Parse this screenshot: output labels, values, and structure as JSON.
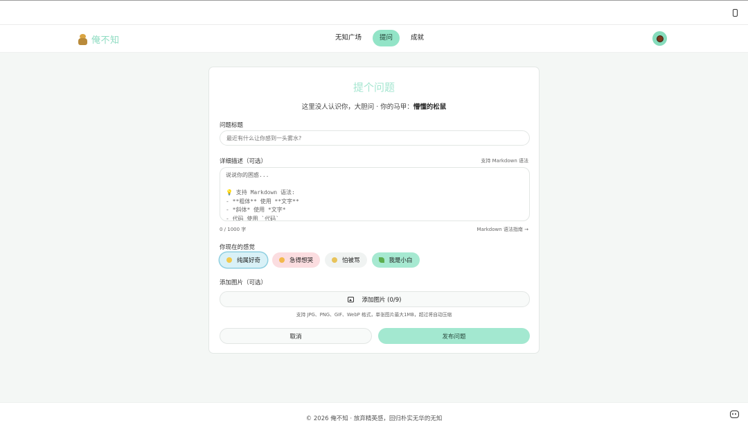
{
  "brand": {
    "name": "俺不知"
  },
  "nav": {
    "links": [
      {
        "label": "无知广场",
        "active": false
      },
      {
        "label": "提问",
        "active": true
      },
      {
        "label": "成就",
        "active": false
      }
    ]
  },
  "form": {
    "heading": "提个问题",
    "subtitle_prefix": "这里没人认识你，大胆问 · 你的马甲：",
    "alias": "懵懂的松鼠",
    "title_label": "问题标题",
    "title_placeholder": "最近有什么让你感到一头雾水?",
    "desc_label": "详细描述（可选）",
    "markdown_support": "支持 Markdown 语法",
    "desc_placeholder_lines": [
      "说说你的困惑...",
      "",
      "💡 支持 Markdown 语法:",
      "- **粗体** 使用 **文字**",
      "- *斜体* 使用 *文字*",
      "- 代码 使用 `代码`"
    ],
    "char_count": "0 / 1000 字",
    "markdown_guide": "Markdown 语法指南 →",
    "feeling_label": "你现在的感觉",
    "feelings": [
      {
        "label": "纯属好奇",
        "bg": "#d9f1f7",
        "selected": true
      },
      {
        "label": "急得想哭",
        "bg": "#fbdde0",
        "selected": false
      },
      {
        "label": "怕被骂",
        "bg": "#f0f3f2",
        "selected": false
      },
      {
        "label": "我是小白",
        "bg": "#a6e9d1",
        "selected": false
      }
    ],
    "image_label": "添加图片（可选）",
    "add_image_button": "添加图片 (0/9)",
    "image_formats": "支持 JPG、PNG、GIF、WebP 格式，单张图片最大1MB，超过将自动压缩",
    "cancel_button": "取消",
    "submit_button": "发布问题"
  },
  "footer": {
    "text": "© 2026 俺不知 · 放弃精英感，回归朴实无华的无知"
  },
  "colors": {
    "accent": "#93e4c7",
    "title": "#a5e6d0",
    "submit": "#a3e8d0"
  }
}
